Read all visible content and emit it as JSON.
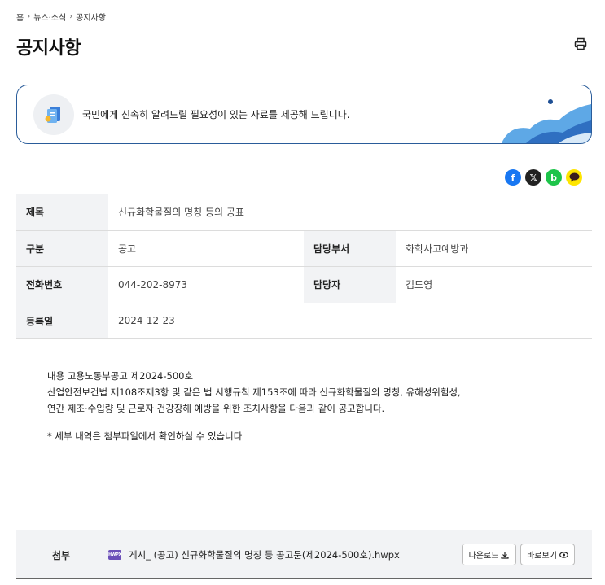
{
  "breadcrumb": {
    "items": [
      "홈",
      "뉴스·소식",
      "공지사항"
    ],
    "separator": "›"
  },
  "page": {
    "title": "공지사항",
    "print_icon": "printer-icon"
  },
  "intro": {
    "text": "국민에게 신속히 알려드릴 필요성이 있는 자료를 제공해 드립니다.",
    "icon": "book-icon"
  },
  "share": {
    "facebook": "f",
    "x": "𝕏",
    "band": "b",
    "kakao": "kakaotalk-icon"
  },
  "info": {
    "title_label": "제목",
    "title_value": "신규화학물질의 명칭 등의 공표",
    "category_label": "구분",
    "category_value": "공고",
    "dept_label": "담당부서",
    "dept_value": "화학사고예방과",
    "phone_label": "전화번호",
    "phone_value": "044-202-8973",
    "manager_label": "담당자",
    "manager_value": "김도영",
    "date_label": "등록일",
    "date_value": "2024-12-23"
  },
  "content": {
    "line1": "내용 고용노동부공고 제2024-500호",
    "line2": "산업안전보건법 제108조제3항 및 같은 법 시행규칙 제153조에 따라 신규화학물질의 명칭, 유해성위험성,",
    "line3": "연간 제조·수입량 및 근로자 건강장해 예방을 위한 조치사항을 다음과 같이 공고합니다.",
    "note": "* 세부 내역은 첨부파일에서 확인하실 수 있습니다"
  },
  "attachment": {
    "label": "첨부",
    "file_badge": "HWPX",
    "file_name": "게시_ (공고) 신규화학물질의 명칭 등 공고문(제2024-500호).hwpx",
    "download_label": "다운로드",
    "view_label": "바로보기"
  },
  "colors": {
    "accent_border": "#2a5c9a",
    "table_header_bg": "#f2f3f5",
    "facebook": "#1877f2",
    "band": "#1dc44a",
    "kakao": "#fee500",
    "file_icon": "#6b4fb8"
  }
}
